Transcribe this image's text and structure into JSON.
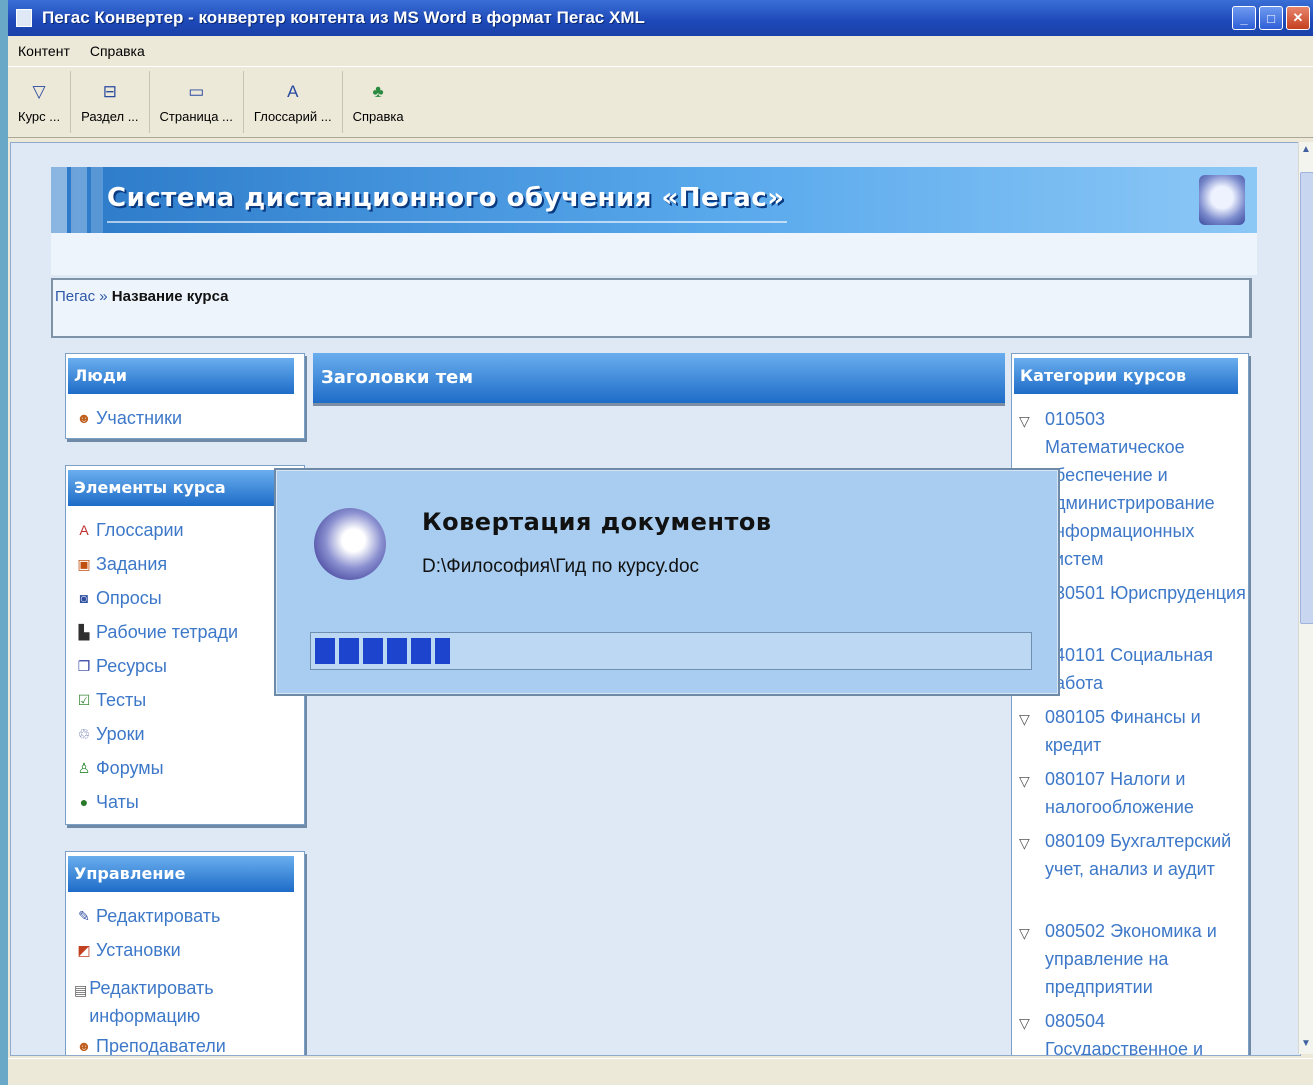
{
  "window": {
    "title": "Пегас Конвертер - конвертер контента из MS Word в формат Пегас XML",
    "controls": [
      "minimize",
      "maximize",
      "close"
    ]
  },
  "menu": [
    "Контент",
    "Справка"
  ],
  "toolbar": [
    {
      "label": "Курс ...",
      "icon": "course-icon"
    },
    {
      "label": "Раздел ...",
      "icon": "section-icon"
    },
    {
      "label": "Страница ...",
      "icon": "page-icon"
    },
    {
      "label": "Глоссарий ...",
      "icon": "glossary-icon"
    },
    {
      "label": "Справка",
      "icon": "help-icon"
    }
  ],
  "banner": {
    "title": "Система дистанционного обучения «Пегас»"
  },
  "breadcrumb": {
    "root": "Пегас",
    "separator": "»",
    "current": "Название курса"
  },
  "left": {
    "people": {
      "title": "Люди",
      "items": [
        "Участники"
      ]
    },
    "course_elements": {
      "title": "Элементы курса",
      "items": [
        "Глоссарии",
        "Задания",
        "Опросы",
        "Рабочие тетради",
        "Ресурсы",
        "Тесты",
        "Уроки",
        "Форумы",
        "Чаты"
      ]
    },
    "management": {
      "title": "Управление",
      "items": [
        "Редактировать",
        "Установки",
        "Редактировать информацию",
        "Преподаватели"
      ]
    }
  },
  "center": {
    "title": "Заголовки тем"
  },
  "right": {
    "title": "Категории курсов",
    "items": [
      "010503 Математическое обеспечение и администрирование информационных систем",
      "030501 Юриспруденция",
      "040101 Социальная работа",
      "080105 Финансы и кредит",
      "080107 Налоги и налогообложение",
      "080109 Бухгалтерский учет, анализ и аудит",
      "080502 Экономика и управление на предприятии",
      "080504 Государственное и"
    ]
  },
  "dialog": {
    "title": "Ковертация документов",
    "path": "D:\\Философия\\Гид по курсу.doc",
    "progress": 0.19
  },
  "colors": {
    "accent": "#1e6cc8",
    "link": "#3d78c8",
    "progress": "#1c44cc"
  }
}
